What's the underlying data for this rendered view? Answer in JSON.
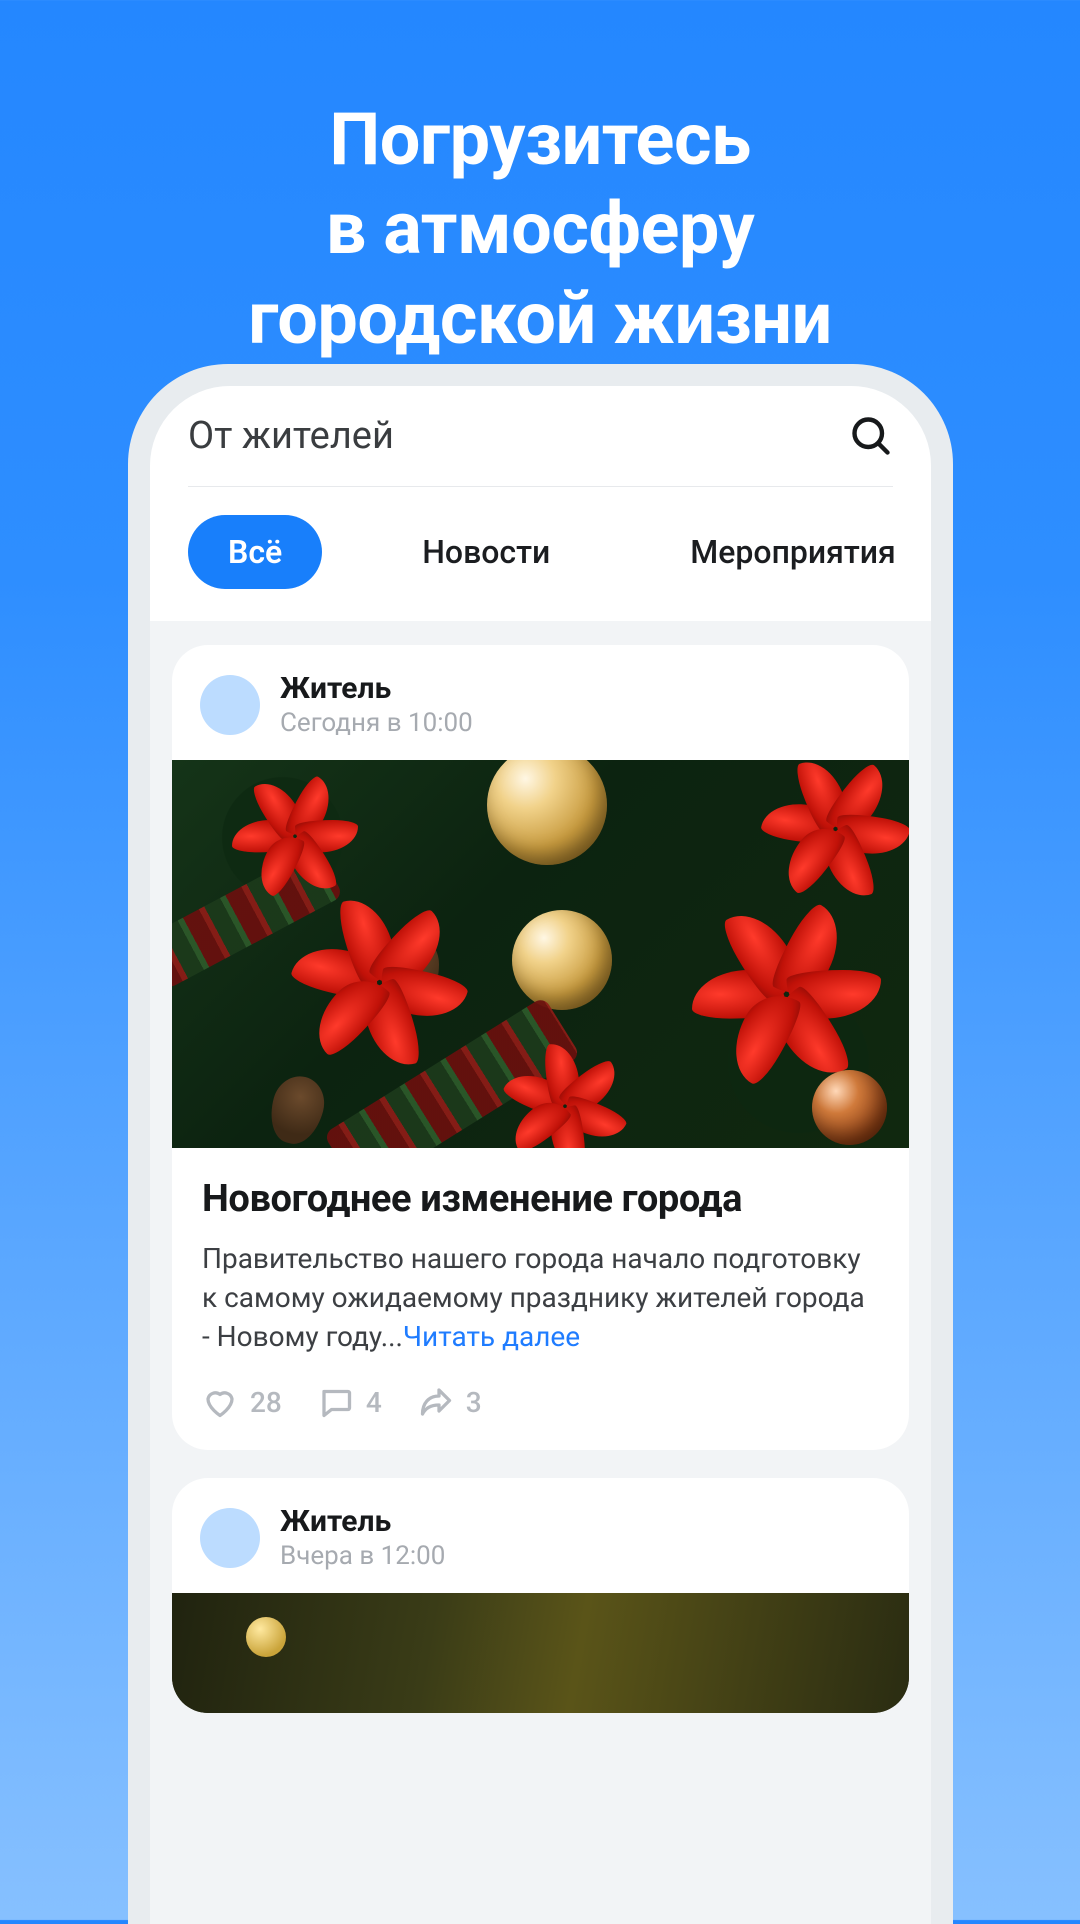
{
  "promo": {
    "line1": "Погрузитесь",
    "line2": "в атмосферу",
    "line3": "городской жизни"
  },
  "header": {
    "title": "От жителей"
  },
  "tabs": {
    "all": "Всё",
    "news": "Новости",
    "events": "Мероприятия"
  },
  "posts": [
    {
      "author": "Житель",
      "time": "Сегодня в 10:00",
      "title": "Новогоднее изменение города",
      "excerpt": "Правительство нашего города начало подготовку к самому ожидаемому празднику жителей города - Новому году...",
      "read_more": "Читать далее",
      "likes": "28",
      "comments": "4",
      "shares": "3"
    },
    {
      "author": "Житель",
      "time": "Вчера в 12:00"
    }
  ]
}
